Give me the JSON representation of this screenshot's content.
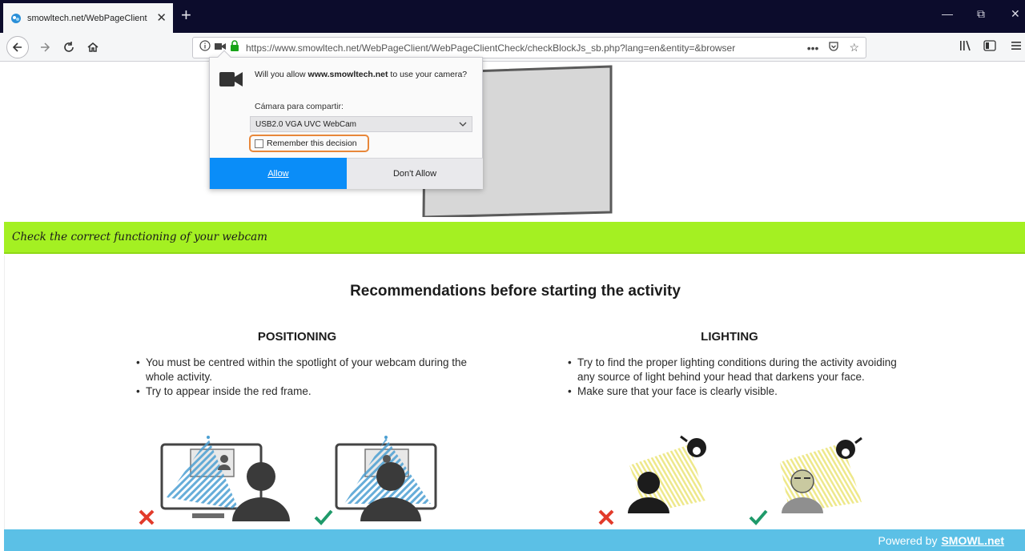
{
  "browser": {
    "tab_title": "smowltech.net/WebPageClient",
    "tab_close": "✕",
    "new_tab": "+",
    "window_controls": {
      "minimize": "—",
      "restore": "⧉",
      "close": "✕"
    },
    "url": "https://www.smowltech.net/WebPageClient/WebPageClientCheck/checkBlockJs_sb.php?lang=en&entity=&browser",
    "nav_icons": [
      "back-icon",
      "forward-icon",
      "reload-icon",
      "home-icon"
    ],
    "url_icons": [
      "info-icon",
      "camera-icon",
      "lock-icon"
    ],
    "url_actions": {
      "more": "•••",
      "pocket": "♡",
      "bookmark": "☆"
    },
    "toolbar_icons": [
      "library-icon",
      "sidebar-icon",
      "menu-icon"
    ],
    "colors": {
      "tabstrip": "#0c0c2c",
      "toolbar": "#f5f6f7"
    }
  },
  "permission_popup": {
    "question_prefix": "Will you allow ",
    "question_domain": "www.smowltech.net",
    "question_suffix": " to use your camera?",
    "device_label": "Cámara para compartir:",
    "selected_device": "USB2.0 VGA UVC WebCam",
    "remember_label": "Remember this decision",
    "remember_checked": false,
    "allow_label": "Allow",
    "deny_label": "Don't Allow",
    "colors": {
      "allow": "#0a8df8",
      "highlight": "#e8873a"
    }
  },
  "page": {
    "banner_text": "Check the correct functioning of your webcam",
    "title": "Recommendations before starting the activity",
    "positioning": {
      "heading": "POSITIONING",
      "bullets": [
        "You must be centred within the spotlight of your webcam during the whole activity.",
        "Try to appear inside the red frame."
      ]
    },
    "lighting": {
      "heading": "LIGHTING",
      "bullets": [
        "Try to find the proper lighting conditions during the activity avoiding any source of light behind your head that darkens your face.",
        "Make sure that your face is clearly visible."
      ]
    },
    "footer_prefix": "Powered by",
    "footer_brand": "SMOWL.net",
    "colors": {
      "banner": "#a4f022",
      "footer": "#5bc0e6",
      "wrong": "#e23b2b",
      "right": "#1f9a6a"
    }
  }
}
